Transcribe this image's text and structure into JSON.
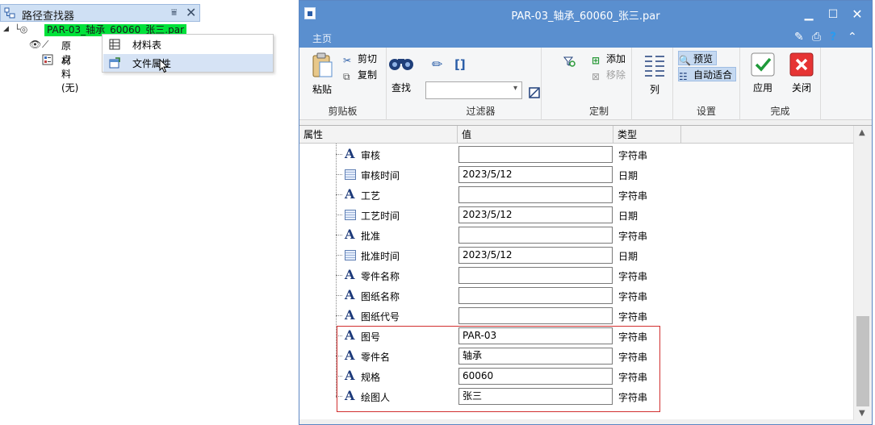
{
  "pathfinder": {
    "title": "路径查找器",
    "root_label": "PAR-03_轴承_60060_张三.par",
    "children": [
      {
        "label": "原点",
        "icon": "eye-icon"
      },
      {
        "label": "材料 (无)",
        "icon": "material-icon"
      }
    ]
  },
  "context_menu": {
    "items": [
      {
        "label": "材料表",
        "icon": "table-icon"
      },
      {
        "label": "文件属性",
        "icon": "file-properties-icon",
        "hovered": true
      }
    ]
  },
  "window": {
    "title": "PAR-03_轴承_60060_张三.par",
    "tab_home": "主页"
  },
  "ribbon": {
    "clipboard": {
      "paste": "粘贴",
      "cut": "剪切",
      "copy": "复制",
      "group": "剪贴板"
    },
    "find": {
      "label": "查找"
    },
    "filter": {
      "bracket_label": "[]",
      "group": "过滤器"
    },
    "customize": {
      "add": "添加",
      "remove": "移除",
      "group": "定制"
    },
    "columns": {
      "label": "列"
    },
    "settings": {
      "preview": "预览",
      "auto_fit": "自动适合",
      "group": "设置"
    },
    "finish": {
      "apply": "应用",
      "close": "关闭",
      "group": "完成"
    }
  },
  "grid": {
    "columns": [
      "属性",
      "值",
      "类型"
    ],
    "rows": [
      {
        "name": "审核",
        "value": "",
        "type": "字符串",
        "icon": "string-icon"
      },
      {
        "name": "审核时间",
        "value": "2023/5/12",
        "type": "日期",
        "icon": "date-icon"
      },
      {
        "name": "工艺",
        "value": "",
        "type": "字符串",
        "icon": "string-icon"
      },
      {
        "name": "工艺时间",
        "value": "2023/5/12",
        "type": "日期",
        "icon": "date-icon"
      },
      {
        "name": "批准",
        "value": "",
        "type": "字符串",
        "icon": "string-icon"
      },
      {
        "name": "批准时间",
        "value": "2023/5/12",
        "type": "日期",
        "icon": "date-icon"
      },
      {
        "name": "零件名称",
        "value": "",
        "type": "字符串",
        "icon": "string-icon"
      },
      {
        "name": "图纸名称",
        "value": "",
        "type": "字符串",
        "icon": "string-icon"
      },
      {
        "name": "图纸代号",
        "value": "",
        "type": "字符串",
        "icon": "string-icon"
      },
      {
        "name": "图号",
        "value": "PAR-03",
        "type": "字符串",
        "icon": "string-icon"
      },
      {
        "name": "零件名",
        "value": "轴承",
        "type": "字符串",
        "icon": "string-icon"
      },
      {
        "name": "规格",
        "value": "60060",
        "type": "字符串",
        "icon": "string-icon"
      },
      {
        "name": "绘图人",
        "value": "张三",
        "type": "字符串",
        "icon": "string-icon"
      }
    ]
  },
  "colors": {
    "titlebar": "#5a8fcf",
    "root_highlight": "#00e23a",
    "highlight_box": "#d12f2f",
    "hover": "#d6e3f5"
  }
}
